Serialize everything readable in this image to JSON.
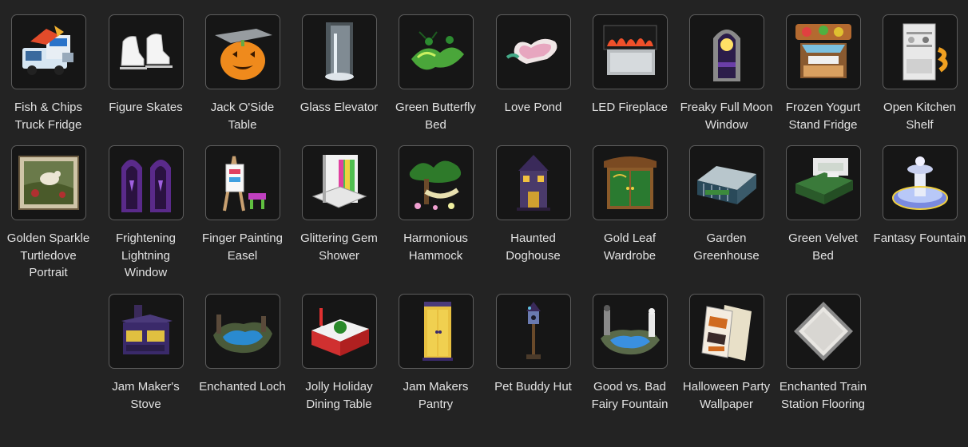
{
  "items": [
    {
      "label": "Fish & Chips Truck Fridge",
      "icon": "food-truck-icon"
    },
    {
      "label": "Figure Skates",
      "icon": "ice-skates-icon"
    },
    {
      "label": "Jack O'Side Table",
      "icon": "pumpkin-table-icon"
    },
    {
      "label": "Glass Elevator",
      "icon": "elevator-icon"
    },
    {
      "label": "Green Butterfly Bed",
      "icon": "butterfly-bed-icon"
    },
    {
      "label": "Love Pond",
      "icon": "heart-pond-icon"
    },
    {
      "label": "LED Fireplace",
      "icon": "fireplace-icon"
    },
    {
      "label": "Freaky Full Moon Window",
      "icon": "moon-window-icon"
    },
    {
      "label": "Frozen Yogurt Stand Fridge",
      "icon": "yogurt-stand-icon"
    },
    {
      "label": "Open Kitchen Shelf",
      "icon": "kitchen-shelf-icon"
    },
    {
      "label": "Golden Sparkle Turtledove Portrait",
      "icon": "bird-portrait-icon"
    },
    {
      "label": "Frightening Lightning Window",
      "icon": "gothic-window-icon"
    },
    {
      "label": "Finger Painting Easel",
      "icon": "easel-icon"
    },
    {
      "label": "Glittering Gem Shower",
      "icon": "shower-icon"
    },
    {
      "label": "Harmonious Hammock",
      "icon": "hammock-icon"
    },
    {
      "label": "Haunted Doghouse",
      "icon": "haunted-house-icon"
    },
    {
      "label": "Gold Leaf Wardrobe",
      "icon": "wardrobe-icon"
    },
    {
      "label": "Garden Greenhouse",
      "icon": "greenhouse-icon"
    },
    {
      "label": "Green Velvet Bed",
      "icon": "bed-icon"
    },
    {
      "label": "Fantasy Fountain",
      "icon": "fountain-icon"
    },
    {
      "label": "Jam Maker's Stove",
      "icon": "stove-icon"
    },
    {
      "label": "Enchanted Loch",
      "icon": "loch-icon"
    },
    {
      "label": "Jolly Holiday Dining Table",
      "icon": "dining-table-icon"
    },
    {
      "label": "Jam Makers Pantry",
      "icon": "pantry-icon"
    },
    {
      "label": "Pet Buddy Hut",
      "icon": "birdhouse-icon"
    },
    {
      "label": "Good vs. Bad Fairy Fountain",
      "icon": "fairy-fountain-icon"
    },
    {
      "label": "Halloween Party Wallpaper",
      "icon": "wallpaper-icon"
    },
    {
      "label": "Enchanted Train Station Flooring",
      "icon": "floor-tile-icon"
    }
  ]
}
